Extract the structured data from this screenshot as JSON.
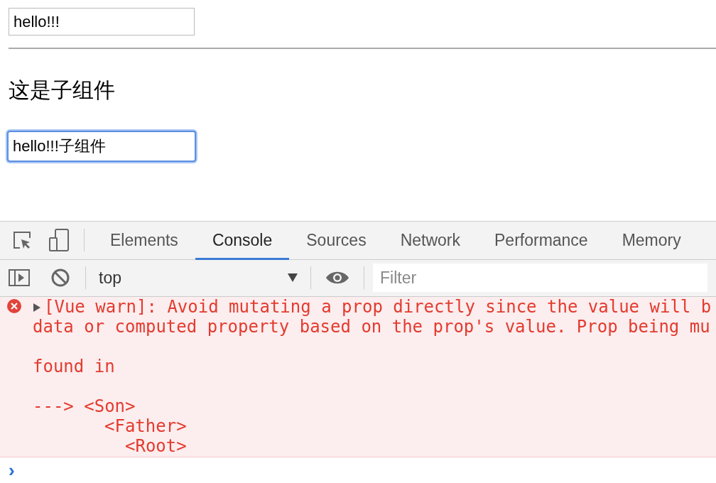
{
  "page": {
    "parent_input": {
      "value": "hello!!!"
    },
    "heading": "这是子组件",
    "child_input": {
      "value": "hello!!!子组件",
      "focused": true
    }
  },
  "devtools": {
    "tabs": [
      {
        "label": "Elements",
        "selected": false
      },
      {
        "label": "Console",
        "selected": true
      },
      {
        "label": "Sources",
        "selected": false
      },
      {
        "label": "Network",
        "selected": false
      },
      {
        "label": "Performance",
        "selected": false
      },
      {
        "label": "Memory",
        "selected": false
      }
    ],
    "context": "top",
    "filter": {
      "placeholder": "Filter"
    },
    "message": {
      "kind": "error",
      "expanded": false,
      "lines": [
        "[Vue warn]: Avoid mutating a prop directly since the value will b",
        "data or computed property based on the prop's value. Prop being mu"
      ],
      "found_in": "found in",
      "arrow": "--->",
      "trace": [
        {
          "name": "<Son>",
          "children": [
            {
              "name": "<Father>",
              "children": [
                {
                  "name": "<Root>"
                }
              ]
            }
          ]
        }
      ]
    },
    "prompt": "›"
  }
}
